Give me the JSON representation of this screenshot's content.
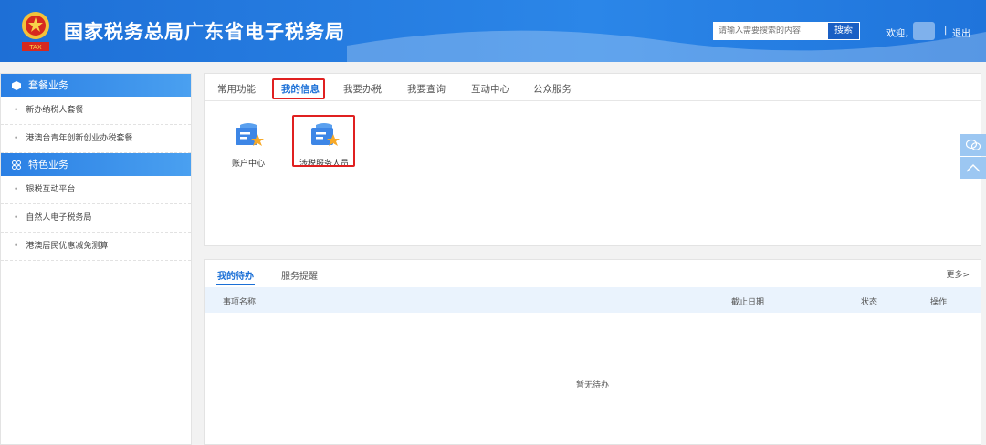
{
  "header": {
    "title": "国家税务总局广东省电子税务局",
    "emblem_text": "TAX",
    "search_placeholder": "请输入需要搜索的内容",
    "search_label": "搜索",
    "welcome": "欢迎，",
    "separator": "|",
    "logout_label": "退出",
    "brand_color": "#1e6fd6"
  },
  "sidebar": {
    "section1": {
      "label": "套餐业务",
      "icon": "cube-icon"
    },
    "section1_items": [
      "新办纳税人套餐",
      "港澳台青年创新创业办税套餐"
    ],
    "section2": {
      "label": "特色业务",
      "icon": "grid-icon"
    },
    "section2_items": [
      "银税互动平台",
      "自然人电子税务局",
      "港澳居民优惠减免测算"
    ]
  },
  "tabs": [
    "常用功能",
    "我的信息",
    "我要办税",
    "我要查询",
    "互动中心",
    "公众服务"
  ],
  "active_tab": "我的信息",
  "apps": [
    {
      "label": "账户中心",
      "icon": "account-star-icon"
    },
    {
      "label": "涉税服务人员",
      "icon": "service-star-icon"
    }
  ],
  "todo": {
    "tabs": [
      "我的待办",
      "服务提醒"
    ],
    "more_label": "更多>",
    "columns": [
      "事项名称",
      "截止日期",
      "状态",
      "操作"
    ],
    "empty_text": "暂无待办"
  },
  "highlight_color": "#e02020"
}
